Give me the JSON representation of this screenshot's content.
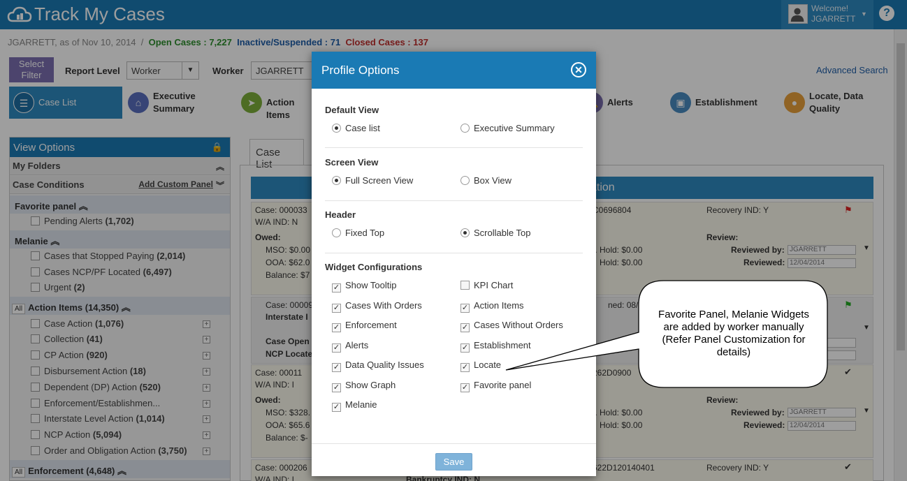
{
  "app": {
    "title": "Track My Cases",
    "welcome_line1": "Welcome!",
    "welcome_line2": "JGARRETT",
    "help_label": "?"
  },
  "status": {
    "user_date": "JGARRETT, as of Nov 10, 2014",
    "separator": "/",
    "open_cases": "Open Cases : 7,227",
    "inactive": "Inactive/Suspended : 71",
    "closed_cases": "Closed Cases : 137"
  },
  "filter": {
    "select_filter": "Select Filter",
    "report_level_label": "Report Level",
    "report_level_value": "Worker",
    "worker_label": "Worker",
    "worker_value": "JGARRETT",
    "advanced_search": "Advanced Search"
  },
  "nav_tabs": [
    {
      "label": "Case List",
      "icon": "list-icon",
      "color": "#2e8ac0"
    },
    {
      "label": "Executive Summary",
      "icon": "home-icon",
      "color": "#5a6fbf"
    },
    {
      "label": "Action Items",
      "icon": "paper-plane-icon",
      "color": "#7cae3a"
    },
    {
      "label": "Alerts",
      "icon": "bell-icon",
      "color": "#7b6fb0"
    },
    {
      "label": "Establishment",
      "icon": "briefcase-icon",
      "color": "#4a8bc0"
    },
    {
      "label": "Locate, Data Quality",
      "icon": "map-pin-icon",
      "color": "#e8a03a"
    }
  ],
  "view_options": {
    "title": "View Options",
    "my_folders": "My Folders",
    "case_conditions": "Case Conditions",
    "add_custom_panel": "Add Custom Panel",
    "favorite_panel": "Favorite panel",
    "favorite_items": [
      {
        "label": "Pending Alerts",
        "count": "(1,702)"
      }
    ],
    "melanie": "Melanie",
    "melanie_items": [
      {
        "label": "Cases that Stopped Paying",
        "count": "(2,014)"
      },
      {
        "label": "Cases NCP/PF Located",
        "count": "(6,497)"
      },
      {
        "label": "Urgent",
        "count": "(2)"
      }
    ],
    "all_label": "All",
    "action_items": "Action Items (14,350)",
    "action_list": [
      {
        "label": "Case Action",
        "count": "(1,076)"
      },
      {
        "label": "Collection",
        "count": "(41)"
      },
      {
        "label": "CP Action",
        "count": "(920)"
      },
      {
        "label": "Disbursement Action",
        "count": "(18)"
      },
      {
        "label": "Dependent (DP) Action",
        "count": "(520)"
      },
      {
        "label": "Enforcement/Establishmen...",
        "count": ""
      },
      {
        "label": "Interstate Level Action",
        "count": "(1,014)"
      },
      {
        "label": "NCP Action",
        "count": "(5,094)"
      },
      {
        "label": "Order and Obligation Action",
        "count": "(3,750)"
      }
    ],
    "enforcement": "Enforcement (4,648)"
  },
  "main": {
    "case_tab": "Case List",
    "band_text": "ation",
    "card1": {
      "case": "Case: 000033",
      "wa": "W/A IND: N",
      "case_id_tail": "C0696804",
      "recovery": "Recovery IND: Y",
      "owed": "Owed:",
      "mso": "MSO: $0.00",
      "ooa": "OOA: $62.0",
      "balance": "Balance: $7",
      "hold1": "t. Hold: $0.00",
      "hold2": "Hold: $0.00",
      "review": "Review:",
      "reviewed_by_label": "Reviewed by:",
      "reviewed_by": "JGARRETT",
      "reviewed_label": "Reviewed:",
      "reviewed": "12/04/2014"
    },
    "card2": {
      "case": "Case: 00009",
      "interstate": "Interstate I",
      "opened": "ned: 08/2",
      "case_open": "Case Open",
      "ncp_locate": "NCP Locate"
    },
    "card3": {
      "case": "Case: 00011",
      "wa": "W/A IND: I",
      "case_id_tail": "262D0900",
      "owed": "Owed:",
      "mso": "MSO: $328.",
      "ooa": "OOA: $65.6",
      "balance": "Balance: $-",
      "hold1": "t. Hold: $0.00",
      "hold2": "Hold: $0.00",
      "review": "Review:",
      "reviewed_by_label": "Reviewed by:",
      "reviewed_by": "JGARRETT",
      "reviewed_label": "Reviewed:",
      "reviewed": "12/04/2014"
    },
    "card4": {
      "case": "Case: 000206",
      "wa": "W/A IND: I",
      "case_id_tail": "622D120140401",
      "recovery": "Recovery IND: Y",
      "bankruptcy": "Bankruptcy IND: N"
    }
  },
  "modal": {
    "title": "Profile Options",
    "default_view": {
      "title": "Default View",
      "options": [
        {
          "label": "Case list",
          "selected": true
        },
        {
          "label": "Executive Summary",
          "selected": false
        }
      ]
    },
    "screen_view": {
      "title": "Screen View",
      "options": [
        {
          "label": "Full Screen View",
          "selected": true
        },
        {
          "label": "Box View",
          "selected": false
        }
      ]
    },
    "header": {
      "title": "Header",
      "options": [
        {
          "label": "Fixed Top",
          "selected": false
        },
        {
          "label": "Scrollable Top",
          "selected": true
        }
      ]
    },
    "widgets": {
      "title": "Widget Configurations",
      "left": [
        {
          "label": "Show Tooltip",
          "checked": true
        },
        {
          "label": "Cases With Orders",
          "checked": true
        },
        {
          "label": "Enforcement",
          "checked": true
        },
        {
          "label": "Alerts",
          "checked": true
        },
        {
          "label": "Data Quality Issues",
          "checked": true
        },
        {
          "label": "Show Graph",
          "checked": true
        },
        {
          "label": "Melanie",
          "checked": true
        }
      ],
      "right": [
        {
          "label": "KPI Chart",
          "checked": false
        },
        {
          "label": "Action Items",
          "checked": true
        },
        {
          "label": "Cases Without Orders",
          "checked": true
        },
        {
          "label": "Establishment",
          "checked": true
        },
        {
          "label": "Locate",
          "checked": true
        },
        {
          "label": "Favorite panel",
          "checked": true
        }
      ]
    },
    "save": "Save",
    "close": "✕"
  },
  "callout": {
    "line1": "Favorite Panel, Melanie Widgets",
    "line2": "are added by worker manually",
    "line3": "(Refer Panel Customization for",
    "line4": "details)"
  },
  "colors": {
    "brand": "#1a7ab4",
    "open": "#2e8f2e",
    "inactive": "#1f5ea8",
    "closed": "#c0302e"
  }
}
